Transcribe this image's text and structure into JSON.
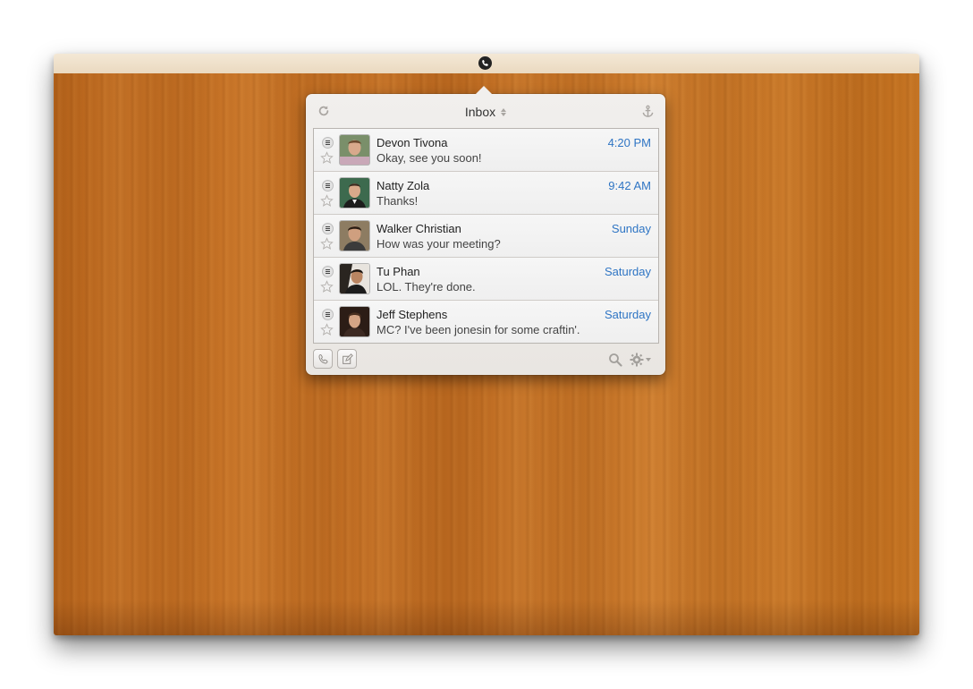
{
  "popover": {
    "title": "Inbox",
    "toolbar": {
      "refresh_icon": "refresh-icon",
      "anchor_icon": "anchor-icon"
    },
    "messages": [
      {
        "name": "Devon Tivona",
        "preview": "Okay, see you soon!",
        "time": "4:20 PM",
        "avatar_color": "#b78f78"
      },
      {
        "name": "Natty Zola",
        "preview": "Thanks!",
        "time": "9:42 AM",
        "avatar_color": "#3d5b45"
      },
      {
        "name": "Walker Christian",
        "preview": "How was your meeting?",
        "time": "Sunday",
        "avatar_color": "#7a6a55"
      },
      {
        "name": "Tu Phan",
        "preview": "LOL. They're done.",
        "time": "Saturday",
        "avatar_color": "#5a4a3c"
      },
      {
        "name": "Jeff Stephens",
        "preview": "MC? I've been jonesin for some craftin'.",
        "time": "Saturday",
        "avatar_color": "#3a2a22"
      }
    ],
    "bottom": {
      "call_icon": "phone-icon",
      "compose_icon": "compose-icon",
      "search_icon": "search-icon",
      "settings_icon": "gear-icon"
    }
  },
  "colors": {
    "time_accent": "#2f75c4",
    "wood": "#c4711f",
    "menubar": "#efe2cd"
  }
}
